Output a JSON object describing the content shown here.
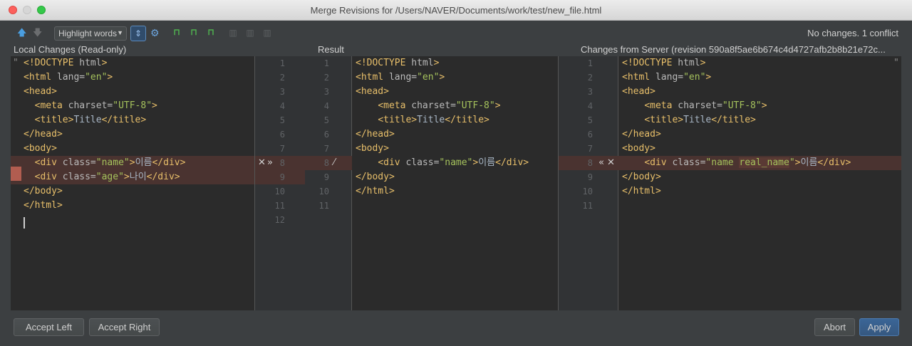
{
  "window": {
    "title": "Merge Revisions for /Users/NAVER/Documents/work/test/new_file.html"
  },
  "toolbar": {
    "prev_diff_icon": "arrow-up-icon",
    "next_diff_icon": "arrow-down-icon",
    "highlight_mode": "Highlight words",
    "status": "No changes. 1 conflict"
  },
  "panes": {
    "left_header": "Local Changes (Read-only)",
    "middle_header": "Result",
    "right_header": "Changes from Server (revision 590a8f5ae6b674c4d4727afb2b8b21e72c..."
  },
  "left_lines": [
    [
      "<!DOCTYPE html>"
    ],
    [
      "<html lang=\"en\">"
    ],
    [
      "<head>"
    ],
    [
      "  <meta charset=\"UTF-8\">"
    ],
    [
      "  <title>Title</title>"
    ],
    [
      "</head>"
    ],
    [
      "<body>"
    ],
    [
      "  <div class=\"name\">이름</div>"
    ],
    [
      "  <div class=\"age\">나이</div>"
    ],
    [
      "</body>"
    ],
    [
      "</html>"
    ],
    [
      ""
    ]
  ],
  "middle_lines": [
    "<!DOCTYPE html>",
    "<html lang=\"en\">",
    "<head>",
    "    <meta charset=\"UTF-8\">",
    "    <title>Title</title>",
    "</head>",
    "<body>",
    "    <div class=\"name\">이름</div>",
    "</body>",
    "</html>",
    ""
  ],
  "right_lines": [
    "<!DOCTYPE html>",
    "<html lang=\"en\">",
    "<head>",
    "    <meta charset=\"UTF-8\">",
    "    <title>Title</title>",
    "</head>",
    "<body>",
    "    <div class=\"name real_name\">이름</div>",
    "</body>",
    "</html>",
    ""
  ],
  "gutter_left_numbers": [
    "1",
    "2",
    "3",
    "4",
    "5",
    "6",
    "7",
    "8",
    "9",
    "10",
    "11",
    "12"
  ],
  "gutter_mid_numbers": [
    "1",
    "2",
    "3",
    "4",
    "5",
    "6",
    "7",
    "8",
    "9",
    "10",
    "11"
  ],
  "gutter_right_numbers": [
    "1",
    "2",
    "3",
    "4",
    "5",
    "6",
    "7",
    "8",
    "9",
    "10",
    "11"
  ],
  "actions": {
    "ignore_left": "✕",
    "apply_left": "»",
    "apply_right": "«",
    "ignore_right": "✕",
    "magic_resolve_icon": "magic-wand-icon"
  },
  "buttons": {
    "accept_left": "Accept Left",
    "accept_right": "Accept Right",
    "abort": "Abort",
    "apply": "Apply"
  }
}
